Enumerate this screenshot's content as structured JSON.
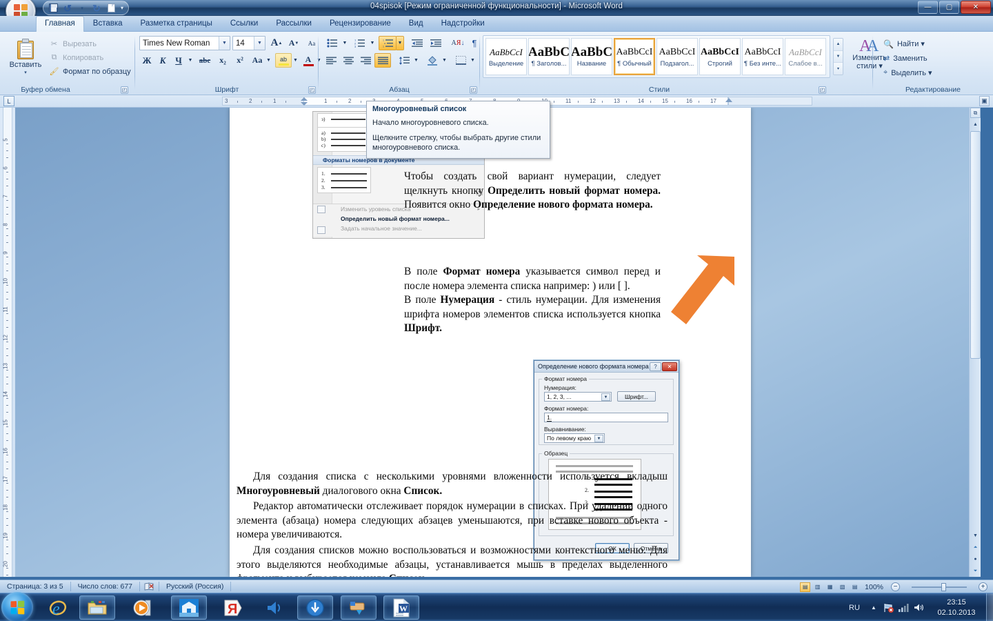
{
  "window": {
    "title": "04spisok [Режим ограниченной функциональности] - Microsoft Word",
    "minimize": "—",
    "maximize": "▢",
    "close": "✕"
  },
  "qat": {
    "items": [
      {
        "name": "save-icon",
        "label": "Сохранить"
      },
      {
        "name": "undo-icon",
        "label": "Отменить"
      },
      {
        "name": "undo-dropdown-icon",
        "label": "▾"
      },
      {
        "name": "redo-icon",
        "label": "Вернуть"
      },
      {
        "name": "new-doc-icon",
        "label": "Создать"
      }
    ],
    "customize": "▾"
  },
  "ribbon": {
    "tabs": [
      {
        "label": "Главная",
        "active": true
      },
      {
        "label": "Вставка",
        "active": false
      },
      {
        "label": "Разметка страницы",
        "active": false
      },
      {
        "label": "Ссылки",
        "active": false
      },
      {
        "label": "Рассылки",
        "active": false
      },
      {
        "label": "Рецензирование",
        "active": false
      },
      {
        "label": "Вид",
        "active": false
      },
      {
        "label": "Надстройки",
        "active": false
      }
    ],
    "groups": {
      "clipboard": {
        "label": "Буфер обмена",
        "paste": "Вставить",
        "paste_caret": "▾",
        "cut": "Вырезать",
        "copy": "Копировать",
        "format_painter": "Формат по образцу"
      },
      "font": {
        "label": "Шрифт",
        "font_name": "Times New Roman",
        "font_size": "14",
        "grow": "A",
        "shrink": "A",
        "clear_format": "Aa",
        "bold": "Ж",
        "italic": "К",
        "underline": "Ч",
        "strike": "abc",
        "subscript": "x₂",
        "superscript": "x²",
        "change_case": "Aa",
        "highlight": "ab",
        "font_color": "A"
      },
      "paragraph": {
        "label": "Абзац",
        "bullets": "bullet-list",
        "numbering": "numbered-list",
        "multilevel": "multilevel-list",
        "decrease_indent": "decrease-indent",
        "increase_indent": "increase-indent",
        "sort": "sort",
        "show_marks": "¶",
        "align_left": "align-left",
        "align_center": "align-center",
        "align_right": "align-right",
        "align_justify": "align-justify",
        "line_spacing": "line-spacing",
        "shading": "shading",
        "borders": "borders"
      },
      "styles": {
        "label": "Стили",
        "items": [
          {
            "preview": "AaBbCcI",
            "name": "Выделение",
            "style": "italic-serif",
            "selected": false
          },
          {
            "preview": "AaBbC",
            "name": "¶ Заголов...",
            "style": "bold-big",
            "selected": false
          },
          {
            "preview": "AaBbC",
            "name": "Название",
            "style": "bold-big2",
            "selected": false
          },
          {
            "preview": "AaBbCcI",
            "name": "¶ Обычный",
            "style": "normal",
            "selected": true
          },
          {
            "preview": "AaBbCcI",
            "name": "Подзагол...",
            "style": "normal",
            "selected": false
          },
          {
            "preview": "AaBbCcI",
            "name": "Строгий",
            "style": "bold-small",
            "selected": false
          },
          {
            "preview": "AaBbCcI",
            "name": "¶ Без инте...",
            "style": "normal",
            "selected": false
          },
          {
            "preview": "AaBbCcI",
            "name": "Слабое в...",
            "style": "grey-italic",
            "selected": false
          }
        ],
        "change_styles": "Изменить\nстили",
        "change_styles_l1": "Изменить",
        "change_styles_l2": "стили ▾"
      },
      "editing": {
        "label": "Редактирование",
        "find": "Найти ▾",
        "replace": "Заменить",
        "select": "Выделить ▾"
      }
    }
  },
  "rulers": {
    "horizontal": [
      "3",
      "2",
      "1",
      "1",
      "2",
      "3",
      "4",
      "5",
      "6",
      "7",
      "8",
      "9",
      "10",
      "11",
      "12",
      "13",
      "14",
      "15",
      "16",
      "17"
    ],
    "vertical": [
      "5",
      "6",
      "7",
      "8",
      "9",
      "10",
      "11",
      "12",
      "13",
      "14",
      "15",
      "16",
      "17",
      "18",
      "19",
      "20"
    ],
    "tab_selector": "L"
  },
  "tooltip": {
    "title": "Многоуровневый список",
    "line1": "Начало многоуровневого списка.",
    "line2": "Щелкните стрелку, чтобы выбрать другие стили многоуровневого списка."
  },
  "document": {
    "list_gallery": {
      "row1": [
        "з)",
        "",
        ""
      ],
      "row2": [
        "a)",
        "b)",
        "c)"
      ],
      "header": "Форматы номеров в документе",
      "nums": [
        "1.",
        "2.",
        "3."
      ],
      "menu": [
        {
          "label": "Изменить уровень списка",
          "enabled": false,
          "submenu": "▸"
        },
        {
          "label": "Определить новый формат номера...",
          "enabled": true,
          "submenu": ""
        },
        {
          "label": "Задать начальное значение...",
          "enabled": false,
          "submenu": ""
        }
      ]
    },
    "dialog": {
      "title": "Определение нового формата номера",
      "help_btn": "?",
      "close_btn": "✕",
      "group_label": "Формат номера",
      "numbering_label": "Нумерация:",
      "numbering_value": "1, 2, 3, ...",
      "font_button": "Шрифт...",
      "format_label": "Формат номера:",
      "format_value": "1.",
      "align_label": "Выравнивание:",
      "align_value": "По левому краю",
      "sample_label": "Образец",
      "sample_nums": [
        "1.",
        "2.",
        "3."
      ],
      "ok": "ОК",
      "cancel": "Отмена"
    },
    "paragraphs": [
      {
        "id": "p1",
        "runs": [
          {
            "t": "Чтобы создать свой вариант нумерации, следует щелкнуть кнопку ",
            "b": false
          },
          {
            "t": "Определить новый формат номера.",
            "b": true
          },
          {
            "t": " Появится окно ",
            "b": false
          },
          {
            "t": "Определение нового формата номера.",
            "b": true
          }
        ]
      },
      {
        "id": "p2",
        "runs": [
          {
            "t": "В поле ",
            "b": false
          },
          {
            "t": "Формат номера",
            "b": true
          },
          {
            "t": " указывается символ перед и после номера элемента списка например: ) или [ ].",
            "b": false
          }
        ]
      },
      {
        "id": "p3",
        "runs": [
          {
            "t": "В поле ",
            "b": false
          },
          {
            "t": "Нумерация",
            "b": true
          },
          {
            "t": " - стиль нумерации. Для изменения шрифта номеров элементов списка используется кнопка ",
            "b": false
          },
          {
            "t": "Шрифт.",
            "b": true
          }
        ]
      },
      {
        "id": "p4",
        "runs": [
          {
            "t": "Для создания списка с несколькими уровнями вложенности используется вкладыш ",
            "b": false
          },
          {
            "t": "Многоуровневый",
            "b": true
          },
          {
            "t": " диалогового окна ",
            "b": false
          },
          {
            "t": "Список.",
            "b": true
          }
        ]
      },
      {
        "id": "p5",
        "runs": [
          {
            "t": "Редактор автоматически отслеживает порядок нумерации в списках. При удалении одного элемента (абзаца) номера следующих абзацев уменьшаются, при вставке нового объекта - номера увеличиваются.",
            "b": false
          }
        ]
      },
      {
        "id": "p6",
        "runs": [
          {
            "t": "Для создания списков можно воспользоваться и возможностями контекстного меню. Для этого выделяются необходимые абзацы, устанавливается мышь в пределах выделенного фрагмента и выбирается команда ",
            "b": false
          },
          {
            "t": "Список.",
            "b": true
          }
        ]
      }
    ]
  },
  "statusbar": {
    "page": "Страница: 3 из 5",
    "words": "Число слов: 677",
    "proofing_icon": "spellcheck-icon",
    "language": "Русский (Россия)",
    "views": [
      {
        "name": "print-layout-view",
        "glyph": "▤",
        "active": true
      },
      {
        "name": "full-screen-reading-view",
        "glyph": "▥",
        "active": false
      },
      {
        "name": "web-layout-view",
        "glyph": "▦",
        "active": false
      },
      {
        "name": "outline-view",
        "glyph": "▧",
        "active": false
      },
      {
        "name": "draft-view",
        "glyph": "▤",
        "active": false
      }
    ],
    "zoom": "100%",
    "zoom_out": "−",
    "zoom_in": "+"
  },
  "taskbar": {
    "start": "start-orb",
    "items": [
      {
        "name": "internet-explorer-icon",
        "framed": false
      },
      {
        "name": "windows-explorer-icon",
        "framed": true
      },
      {
        "name": "media-player-icon",
        "framed": false
      },
      {
        "name": "app-window-icon",
        "framed": true
      },
      {
        "name": "yandex-icon",
        "framed": false
      },
      {
        "name": "sound-app-icon",
        "framed": false
      },
      {
        "name": "downloader-icon",
        "framed": true
      },
      {
        "name": "punto-switcher-icon",
        "framed": true
      },
      {
        "name": "microsoft-word-icon",
        "framed": true
      }
    ],
    "tray": {
      "language": "RU",
      "show_hidden": "▲",
      "network_flag": "network-icon",
      "signal": "signal-icon",
      "volume": "volume-icon",
      "time": "23:15",
      "date": "02.10.2013"
    }
  }
}
